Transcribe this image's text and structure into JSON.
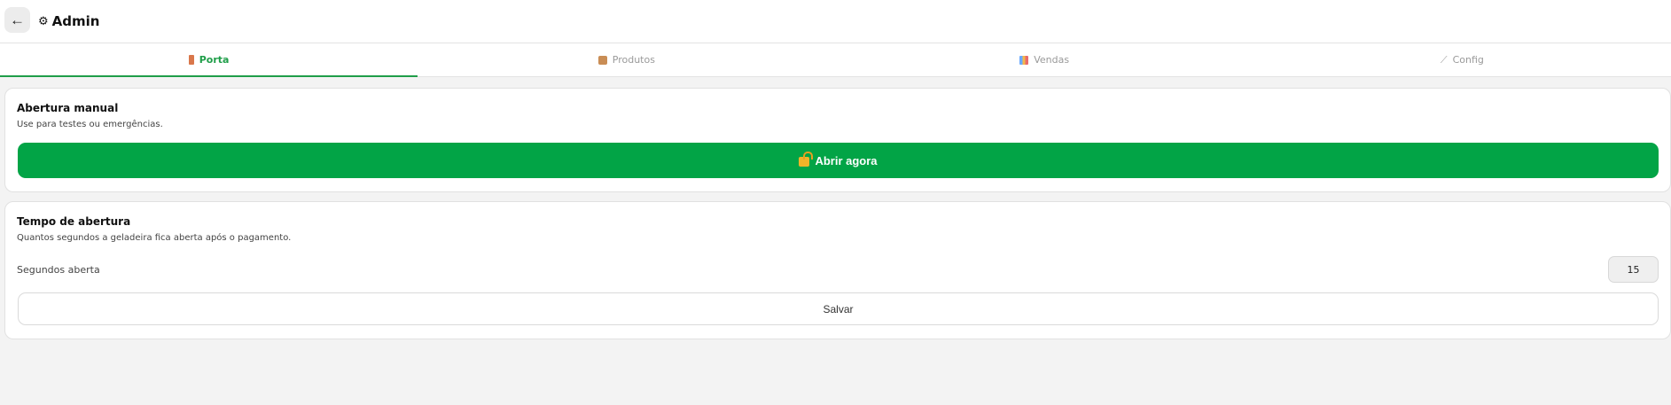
{
  "header": {
    "back_symbol": "←",
    "gear_symbol": "⚙",
    "title": "Admin"
  },
  "tabs": [
    {
      "label": "Porta",
      "icon": "door-icon",
      "active": true
    },
    {
      "label": "Produtos",
      "icon": "package-icon",
      "active": false
    },
    {
      "label": "Vendas",
      "icon": "chart-icon",
      "active": false
    },
    {
      "label": "Config",
      "icon": "wrench-icon",
      "active": false
    }
  ],
  "manual_open": {
    "title": "Abertura manual",
    "subtitle": "Use para testes ou emergências.",
    "button_label": "Abrir agora",
    "button_icon": "unlock-icon"
  },
  "open_time": {
    "title": "Tempo de abertura",
    "subtitle": "Quantos segundos a geladeira fica aberta após o pagamento.",
    "field_label": "Segundos aberta",
    "field_value": "15",
    "save_label": "Salvar"
  },
  "colors": {
    "accent": "#02a446",
    "active_tab": "#1f9e49",
    "background": "#f3f3f3"
  }
}
